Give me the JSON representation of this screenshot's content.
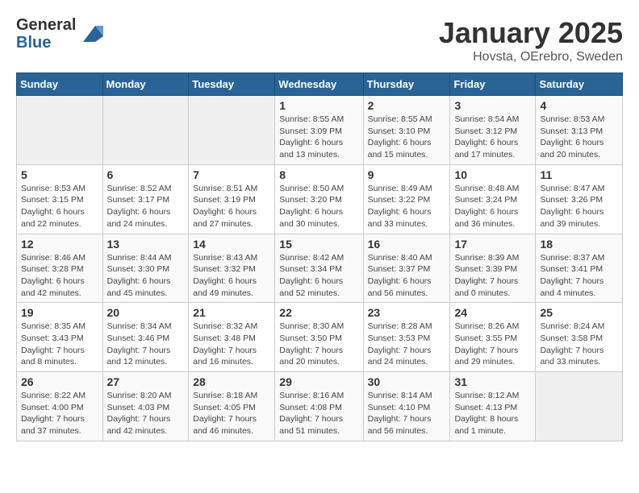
{
  "logo": {
    "general": "General",
    "blue": "Blue"
  },
  "title": "January 2025",
  "location": "Hovsta, OErebro, Sweden",
  "weekdays": [
    "Sunday",
    "Monday",
    "Tuesday",
    "Wednesday",
    "Thursday",
    "Friday",
    "Saturday"
  ],
  "weeks": [
    [
      {
        "day": "",
        "info": ""
      },
      {
        "day": "",
        "info": ""
      },
      {
        "day": "",
        "info": ""
      },
      {
        "day": "1",
        "info": "Sunrise: 8:55 AM\nSunset: 3:09 PM\nDaylight: 6 hours\nand 13 minutes."
      },
      {
        "day": "2",
        "info": "Sunrise: 8:55 AM\nSunset: 3:10 PM\nDaylight: 6 hours\nand 15 minutes."
      },
      {
        "day": "3",
        "info": "Sunrise: 8:54 AM\nSunset: 3:12 PM\nDaylight: 6 hours\nand 17 minutes."
      },
      {
        "day": "4",
        "info": "Sunrise: 8:53 AM\nSunset: 3:13 PM\nDaylight: 6 hours\nand 20 minutes."
      }
    ],
    [
      {
        "day": "5",
        "info": "Sunrise: 8:53 AM\nSunset: 3:15 PM\nDaylight: 6 hours\nand 22 minutes."
      },
      {
        "day": "6",
        "info": "Sunrise: 8:52 AM\nSunset: 3:17 PM\nDaylight: 6 hours\nand 24 minutes."
      },
      {
        "day": "7",
        "info": "Sunrise: 8:51 AM\nSunset: 3:19 PM\nDaylight: 6 hours\nand 27 minutes."
      },
      {
        "day": "8",
        "info": "Sunrise: 8:50 AM\nSunset: 3:20 PM\nDaylight: 6 hours\nand 30 minutes."
      },
      {
        "day": "9",
        "info": "Sunrise: 8:49 AM\nSunset: 3:22 PM\nDaylight: 6 hours\nand 33 minutes."
      },
      {
        "day": "10",
        "info": "Sunrise: 8:48 AM\nSunset: 3:24 PM\nDaylight: 6 hours\nand 36 minutes."
      },
      {
        "day": "11",
        "info": "Sunrise: 8:47 AM\nSunset: 3:26 PM\nDaylight: 6 hours\nand 39 minutes."
      }
    ],
    [
      {
        "day": "12",
        "info": "Sunrise: 8:46 AM\nSunset: 3:28 PM\nDaylight: 6 hours\nand 42 minutes."
      },
      {
        "day": "13",
        "info": "Sunrise: 8:44 AM\nSunset: 3:30 PM\nDaylight: 6 hours\nand 45 minutes."
      },
      {
        "day": "14",
        "info": "Sunrise: 8:43 AM\nSunset: 3:32 PM\nDaylight: 6 hours\nand 49 minutes."
      },
      {
        "day": "15",
        "info": "Sunrise: 8:42 AM\nSunset: 3:34 PM\nDaylight: 6 hours\nand 52 minutes."
      },
      {
        "day": "16",
        "info": "Sunrise: 8:40 AM\nSunset: 3:37 PM\nDaylight: 6 hours\nand 56 minutes."
      },
      {
        "day": "17",
        "info": "Sunrise: 8:39 AM\nSunset: 3:39 PM\nDaylight: 7 hours\nand 0 minutes."
      },
      {
        "day": "18",
        "info": "Sunrise: 8:37 AM\nSunset: 3:41 PM\nDaylight: 7 hours\nand 4 minutes."
      }
    ],
    [
      {
        "day": "19",
        "info": "Sunrise: 8:35 AM\nSunset: 3:43 PM\nDaylight: 7 hours\nand 8 minutes."
      },
      {
        "day": "20",
        "info": "Sunrise: 8:34 AM\nSunset: 3:46 PM\nDaylight: 7 hours\nand 12 minutes."
      },
      {
        "day": "21",
        "info": "Sunrise: 8:32 AM\nSunset: 3:48 PM\nDaylight: 7 hours\nand 16 minutes."
      },
      {
        "day": "22",
        "info": "Sunrise: 8:30 AM\nSunset: 3:50 PM\nDaylight: 7 hours\nand 20 minutes."
      },
      {
        "day": "23",
        "info": "Sunrise: 8:28 AM\nSunset: 3:53 PM\nDaylight: 7 hours\nand 24 minutes."
      },
      {
        "day": "24",
        "info": "Sunrise: 8:26 AM\nSunset: 3:55 PM\nDaylight: 7 hours\nand 29 minutes."
      },
      {
        "day": "25",
        "info": "Sunrise: 8:24 AM\nSunset: 3:58 PM\nDaylight: 7 hours\nand 33 minutes."
      }
    ],
    [
      {
        "day": "26",
        "info": "Sunrise: 8:22 AM\nSunset: 4:00 PM\nDaylight: 7 hours\nand 37 minutes."
      },
      {
        "day": "27",
        "info": "Sunrise: 8:20 AM\nSunset: 4:03 PM\nDaylight: 7 hours\nand 42 minutes."
      },
      {
        "day": "28",
        "info": "Sunrise: 8:18 AM\nSunset: 4:05 PM\nDaylight: 7 hours\nand 46 minutes."
      },
      {
        "day": "29",
        "info": "Sunrise: 8:16 AM\nSunset: 4:08 PM\nDaylight: 7 hours\nand 51 minutes."
      },
      {
        "day": "30",
        "info": "Sunrise: 8:14 AM\nSunset: 4:10 PM\nDaylight: 7 hours\nand 56 minutes."
      },
      {
        "day": "31",
        "info": "Sunrise: 8:12 AM\nSunset: 4:13 PM\nDaylight: 8 hours\nand 1 minute."
      },
      {
        "day": "",
        "info": ""
      }
    ]
  ]
}
